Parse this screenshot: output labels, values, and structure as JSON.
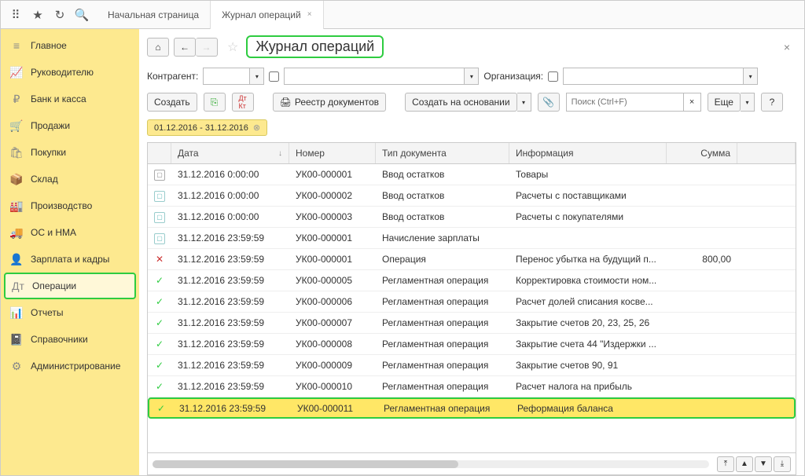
{
  "tabs": {
    "home": "Начальная страница",
    "current": "Журнал операций"
  },
  "sidebar": [
    {
      "icon": "≡",
      "label": "Главное"
    },
    {
      "icon": "📈",
      "label": "Руководителю"
    },
    {
      "icon": "₽",
      "label": "Банк и касса"
    },
    {
      "icon": "🛒",
      "label": "Продажи"
    },
    {
      "icon": "🛍",
      "label": "Покупки"
    },
    {
      "icon": "📦",
      "label": "Склад"
    },
    {
      "icon": "🏭",
      "label": "Производство"
    },
    {
      "icon": "🚚",
      "label": "ОС и НМА"
    },
    {
      "icon": "👤",
      "label": "Зарплата и кадры"
    },
    {
      "icon": "Дт",
      "label": "Операции"
    },
    {
      "icon": "📊",
      "label": "Отчеты"
    },
    {
      "icon": "📓",
      "label": "Справочники"
    },
    {
      "icon": "⚙",
      "label": "Администрирование"
    }
  ],
  "page_title": "Журнал операций",
  "filters": {
    "contractor_label": "Контрагент:",
    "org_label": "Организация:"
  },
  "toolbar": {
    "create": "Создать",
    "registry": "Реестр документов",
    "create_based": "Создать на основании",
    "search_placeholder": "Поиск (Ctrl+F)",
    "more": "Еще"
  },
  "date_range": "01.12.2016 - 31.12.2016",
  "columns": {
    "date": "Дата",
    "number": "Номер",
    "type": "Тип документа",
    "info": "Информация",
    "sum": "Сумма"
  },
  "rows": [
    {
      "ic": "doc2",
      "date": "31.12.2016 0:00:00",
      "num": "УК00-000001",
      "type": "Ввод остатков",
      "info": "Товары",
      "sum": ""
    },
    {
      "ic": "doc",
      "date": "31.12.2016 0:00:00",
      "num": "УК00-000002",
      "type": "Ввод остатков",
      "info": "Расчеты с поставщиками",
      "sum": ""
    },
    {
      "ic": "doc",
      "date": "31.12.2016 0:00:00",
      "num": "УК00-000003",
      "type": "Ввод остатков",
      "info": "Расчеты с покупателями",
      "sum": ""
    },
    {
      "ic": "doc",
      "date": "31.12.2016 23:59:59",
      "num": "УК00-000001",
      "type": "Начисление зарплаты",
      "info": "",
      "sum": ""
    },
    {
      "ic": "red",
      "date": "31.12.2016 23:59:59",
      "num": "УК00-000001",
      "type": "Операция",
      "info": "Перенос убытка на будущий п...",
      "sum": "800,00"
    },
    {
      "ic": "checked",
      "date": "31.12.2016 23:59:59",
      "num": "УК00-000005",
      "type": "Регламентная операция",
      "info": "Корректировка стоимости ном...",
      "sum": ""
    },
    {
      "ic": "checked",
      "date": "31.12.2016 23:59:59",
      "num": "УК00-000006",
      "type": "Регламентная операция",
      "info": "Расчет долей списания косве...",
      "sum": ""
    },
    {
      "ic": "checked",
      "date": "31.12.2016 23:59:59",
      "num": "УК00-000007",
      "type": "Регламентная операция",
      "info": "Закрытие счетов 20, 23, 25, 26",
      "sum": ""
    },
    {
      "ic": "checked",
      "date": "31.12.2016 23:59:59",
      "num": "УК00-000008",
      "type": "Регламентная операция",
      "info": "Закрытие счета 44 \"Издержки ...",
      "sum": ""
    },
    {
      "ic": "checked",
      "date": "31.12.2016 23:59:59",
      "num": "УК00-000009",
      "type": "Регламентная операция",
      "info": "Закрытие счетов 90, 91",
      "sum": ""
    },
    {
      "ic": "checked",
      "date": "31.12.2016 23:59:59",
      "num": "УК00-000010",
      "type": "Регламентная операция",
      "info": "Расчет налога на прибыль",
      "sum": ""
    },
    {
      "ic": "checked",
      "date": "31.12.2016 23:59:59",
      "num": "УК00-000011",
      "type": "Регламентная операция",
      "info": "Реформация баланса",
      "sum": "",
      "sel": true
    }
  ]
}
